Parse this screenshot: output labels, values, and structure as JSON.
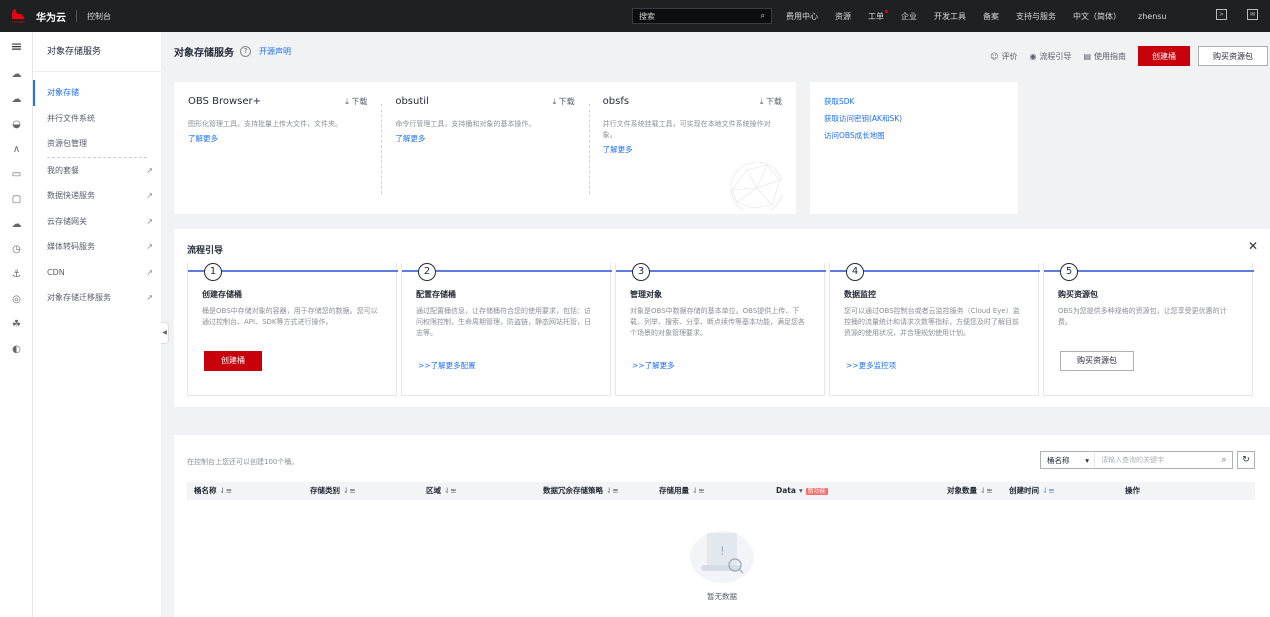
{
  "topbar": {
    "brand": "华为云",
    "console": "控制台",
    "search_placeholder": "搜索",
    "nav": [
      "费用中心",
      "资源",
      "工单",
      "企业",
      "开发工具",
      "备案",
      "支持与服务",
      "中文（简体）",
      "zhensu"
    ]
  },
  "side": {
    "title": "对象存储服务",
    "items": [
      {
        "label": "对象存储",
        "active": true,
        "link": false
      },
      {
        "label": "并行文件系统",
        "active": false,
        "link": false
      },
      {
        "label": "资源包管理",
        "active": false,
        "link": false
      },
      {
        "label": "我的套餐",
        "active": false,
        "link": true
      },
      {
        "label": "数据快递服务",
        "active": false,
        "link": true
      },
      {
        "label": "云存储网关",
        "active": false,
        "link": true
      },
      {
        "label": "媒体转码服务",
        "active": false,
        "link": true
      },
      {
        "label": "CDN",
        "active": false,
        "link": true
      },
      {
        "label": "对象存储迁移服务",
        "active": false,
        "link": true
      }
    ]
  },
  "header": {
    "title": "对象存储服务",
    "open_statement": "开源声明",
    "rate": "评价",
    "guide": "流程引导",
    "usage": "使用指南",
    "create_bucket": "创建桶",
    "buy_package": "购买资源包"
  },
  "tools": [
    {
      "name": "OBS Browser+",
      "download": "下载",
      "desc": "图形化管理工具，支持批量上传大文件，文件夹。",
      "more": "了解更多"
    },
    {
      "name": "obsutil",
      "download": "下载",
      "desc": "命令行管理工具，支持桶和对象的基本操作。",
      "more": "了解更多"
    },
    {
      "name": "obsfs",
      "download": "下载",
      "desc": "并行文件系统挂载工具，可实现在本地文件系统操作对象。",
      "more": "了解更多"
    }
  ],
  "links": [
    "获取SDK",
    "获取访问密钥(AK和SK)",
    "访问OBS成长地图"
  ],
  "guide": {
    "title": "流程引导",
    "steps": [
      {
        "num": "1",
        "name": "创建存储桶",
        "desc": "桶是OBS中存储对象的容器，用于存储您的数据。您可以通过控制台、API、SDK等方式进行操作。",
        "action": "创建桶",
        "action_type": "button-red"
      },
      {
        "num": "2",
        "name": "配置存储桶",
        "desc": "通过配置桶信息，让存储桶符合您的使用要求，包括：访问权限控制，生命周期管理，防盗链，静态网站托管，日志等。",
        "action": ">>了解更多配置",
        "action_type": "link"
      },
      {
        "num": "3",
        "name": "管理对象",
        "desc": "对象是OBS中数据存储的基本单位。OBS提供上传、下载、列举、搜索、分享、断点续传等基本功能，满足您各个场景的对象管理要求。",
        "action": ">>了解更多",
        "action_type": "link"
      },
      {
        "num": "4",
        "name": "数据监控",
        "desc": "您可以通过OBS控制台或者云监控服务（Cloud Eye）监控桶的流量统计和请求次数等指标，方便您及时了解目前资源的使用状况，并合理规划使用计划。",
        "action": ">>更多监控项",
        "action_type": "link"
      },
      {
        "num": "5",
        "name": "购买资源包",
        "desc": "OBS为您提供多种规格的资源包，让您享受更优惠的计费。",
        "action": "购买资源包",
        "action_type": "button-outline"
      }
    ]
  },
  "list": {
    "hint": "在控制台上您还可以创建100个桶。",
    "filter_select": "桶名称",
    "filter_placeholder": "请输入查询的关键字",
    "columns": [
      "桶名称",
      "存储类别",
      "区域",
      "数据冗余存储策略",
      "存储用量",
      "Data",
      "对象数量",
      "创建时间",
      "操作"
    ],
    "new_badge": "新功能",
    "empty": "暂无数据"
  }
}
